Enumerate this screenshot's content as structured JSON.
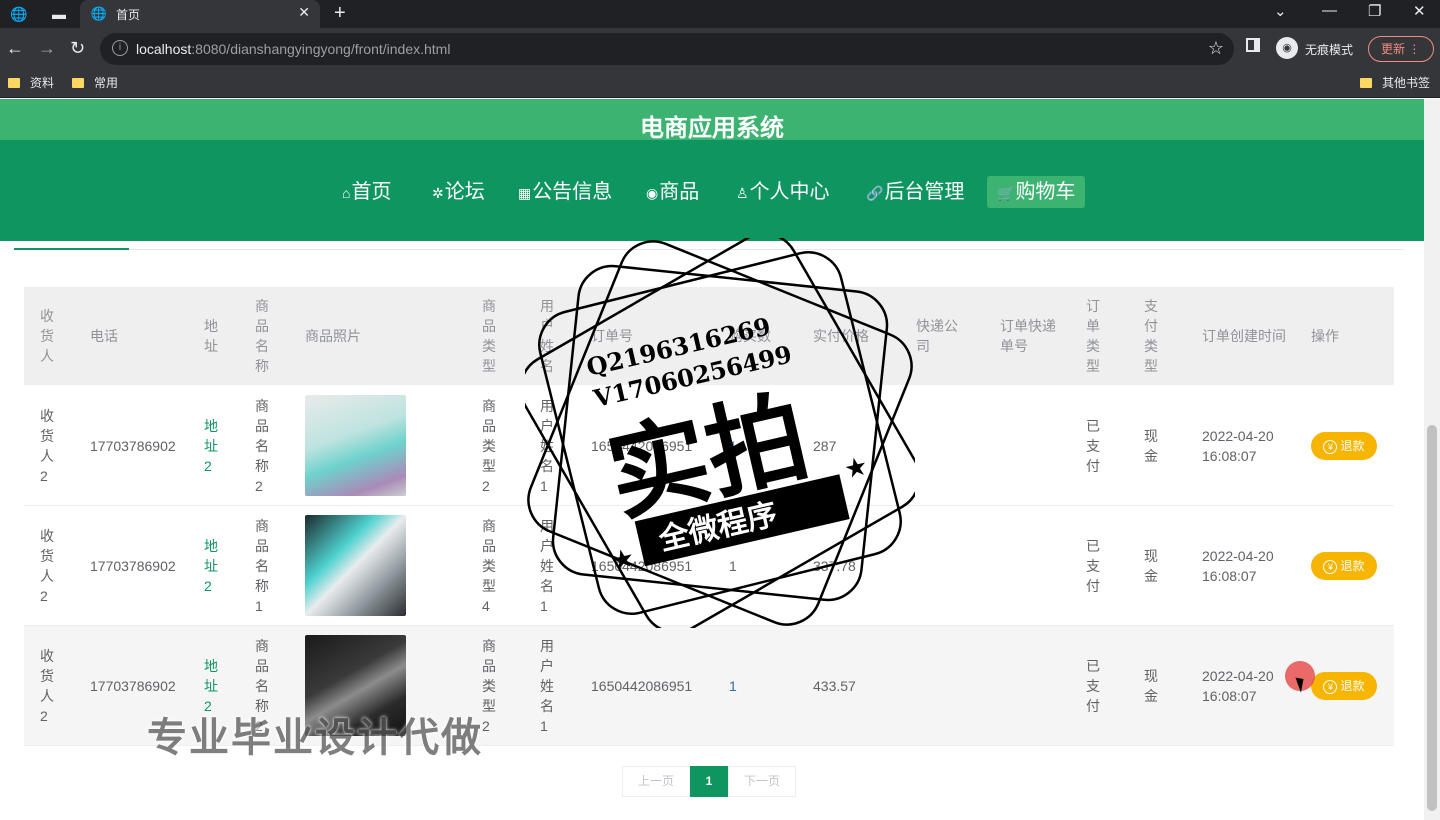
{
  "browser": {
    "tab_title": "首页",
    "url_host": "localhost",
    "url_rest": ":8080/dianshangyingyong/front/index.html",
    "incognito_label": "无痕模式",
    "update_label": "更新",
    "bookmarks": [
      "资料",
      "常用"
    ],
    "other_bookmarks": "其他书签"
  },
  "site": {
    "title": "电商应用系统",
    "nav": [
      {
        "label": "首页",
        "icon": "home-icon"
      },
      {
        "label": "论坛",
        "icon": "forum-icon"
      },
      {
        "label": "公告信息",
        "icon": "grid-icon"
      },
      {
        "label": "商品",
        "icon": "palette-icon"
      },
      {
        "label": "个人中心",
        "icon": "user-icon"
      },
      {
        "label": "后台管理",
        "icon": "link-icon"
      },
      {
        "label": "购物车",
        "icon": "cart-icon"
      }
    ],
    "active_nav": "购物车"
  },
  "table": {
    "headers": [
      "收货人",
      "电话",
      "地址",
      "商品名称",
      "商品照片",
      "商品类型",
      "用户姓名",
      "订单号",
      "购买数",
      "实付价格",
      "快递公司",
      "订单快递单号",
      "订单类型",
      "支付类型",
      "订单创建时间",
      "操作"
    ],
    "rows": [
      {
        "receiver": "收货人2",
        "phone": "17703786902",
        "address": "地址2",
        "product": "商品名称2",
        "image": "teal-storage-box",
        "type": "商品类型2",
        "user": "用户姓名1",
        "order_no": "1650442086951",
        "qty": "1",
        "price": "287",
        "courier": "",
        "tracking": "",
        "order_type": "已支付",
        "pay_type": "现金",
        "created": "2022-04-20 16:08:07",
        "action": "退款"
      },
      {
        "receiver": "收货人2",
        "phone": "17703786902",
        "address": "地址2",
        "product": "商品名称1",
        "image": "laptop-screen",
        "type": "商品类型4",
        "user": "用户姓名1",
        "order_no": "1650442086951",
        "qty": "1",
        "price": "337.78",
        "courier": "",
        "tracking": "",
        "order_type": "已支付",
        "pay_type": "现金",
        "created": "2022-04-20 16:08:07",
        "action": "退款"
      },
      {
        "receiver": "收货人2",
        "phone": "17703786902",
        "address": "地址2",
        "product": "商品名称2",
        "image": "laptop-dark",
        "type": "商品类型2",
        "user": "用户姓名1",
        "order_no": "1650442086951",
        "qty": "1",
        "price": "433.57",
        "courier": "",
        "tracking": "",
        "order_type": "已支付",
        "pay_type": "现金",
        "created": "2022-04-20 16:08:07",
        "action": "退款"
      }
    ]
  },
  "pager": {
    "prev": "上一页",
    "current": "1",
    "next": "下一页"
  },
  "watermark": {
    "qq": "Q2196316269",
    "vx": "V17060256499",
    "big": "实拍",
    "banner": "全微程序",
    "bottom": "专业毕业设计代做"
  },
  "colors": {
    "primary": "#0f9660",
    "accent": "#3cb371",
    "refund": "#f7b500"
  }
}
